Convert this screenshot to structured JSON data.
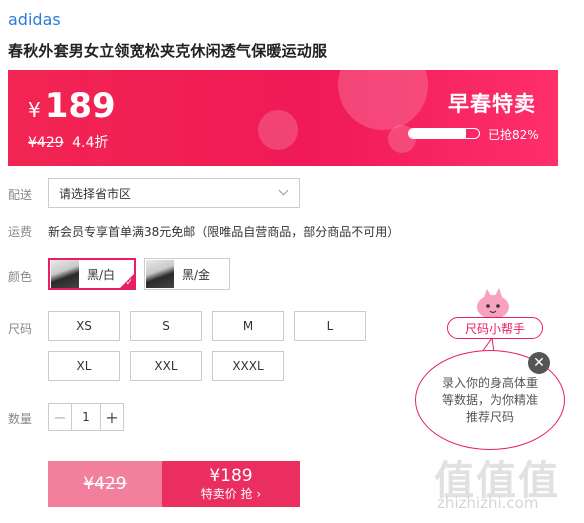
{
  "product": {
    "brand": "adidas",
    "title": "春秋外套男女立领宽松夹克休闲透气保暖运动服"
  },
  "banner": {
    "currency": "¥",
    "price": "189",
    "original_price": "¥429",
    "discount": "4.4折",
    "promo_label": "早春特卖",
    "sold_percent": 82,
    "sold_label": "已抢82%",
    "bg_color": "#f22552"
  },
  "delivery": {
    "label": "配送",
    "value": "请选择省市区"
  },
  "shipping": {
    "label": "运费",
    "text": "新会员专享首单满38元免邮（限唯品自营商品，部分商品不可用）"
  },
  "color": {
    "label": "颜色",
    "options": [
      {
        "label": "黑/白",
        "selected": true
      },
      {
        "label": "黑/金",
        "selected": false
      }
    ],
    "check_icon": "check-icon"
  },
  "size": {
    "label": "尺码",
    "options": [
      "XS",
      "S",
      "M",
      "L",
      "XL",
      "XXL",
      "XXXL"
    ]
  },
  "quantity": {
    "label": "数量",
    "value": "1",
    "minus": "−",
    "plus": "+"
  },
  "buy": {
    "original_price": "¥429",
    "price": "¥189",
    "action": "特卖价 抢 ›"
  },
  "helper": {
    "pill": "尺码小帮手",
    "bubble": "录入你的身高体重等数据，为你精准推荐尺码",
    "close": "✕"
  },
  "watermark": {
    "main": "值值值",
    "sub": "zhizhizhi.com"
  }
}
